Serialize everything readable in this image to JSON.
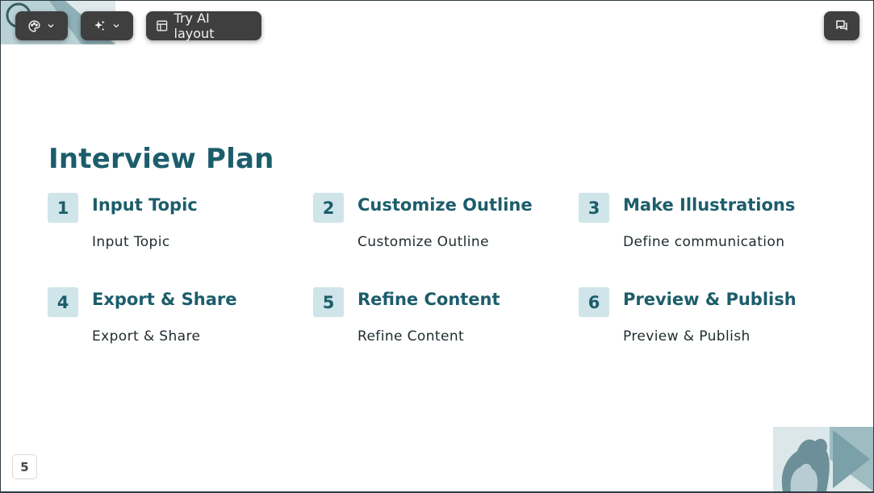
{
  "toolbar": {
    "theme_icon": "palette-icon",
    "ai_icon": "sparkles-icon",
    "layout_label": "Try AI layout",
    "layout_icon": "layout-icon",
    "comment_icon": "comment-icon"
  },
  "slide": {
    "title": "Interview Plan",
    "steps": [
      {
        "number": "1",
        "title": "Input Topic",
        "description": "Input Topic"
      },
      {
        "number": "2",
        "title": "Customize Outline",
        "description": "Customize Outline"
      },
      {
        "number": "3",
        "title": "Make Illustrations",
        "description": "Define communication"
      },
      {
        "number": "4",
        "title": "Export & Share",
        "description": "Export & Share"
      },
      {
        "number": "5",
        "title": "Refine Content",
        "description": "Refine Content"
      },
      {
        "number": "6",
        "title": "Preview & Publish",
        "description": "Preview & Publish"
      }
    ]
  },
  "page_number": "5",
  "colors": {
    "accent": "#1c5d6b",
    "number_bg": "#cfe5ea",
    "toolbar_bg": "#3f3f3f"
  }
}
